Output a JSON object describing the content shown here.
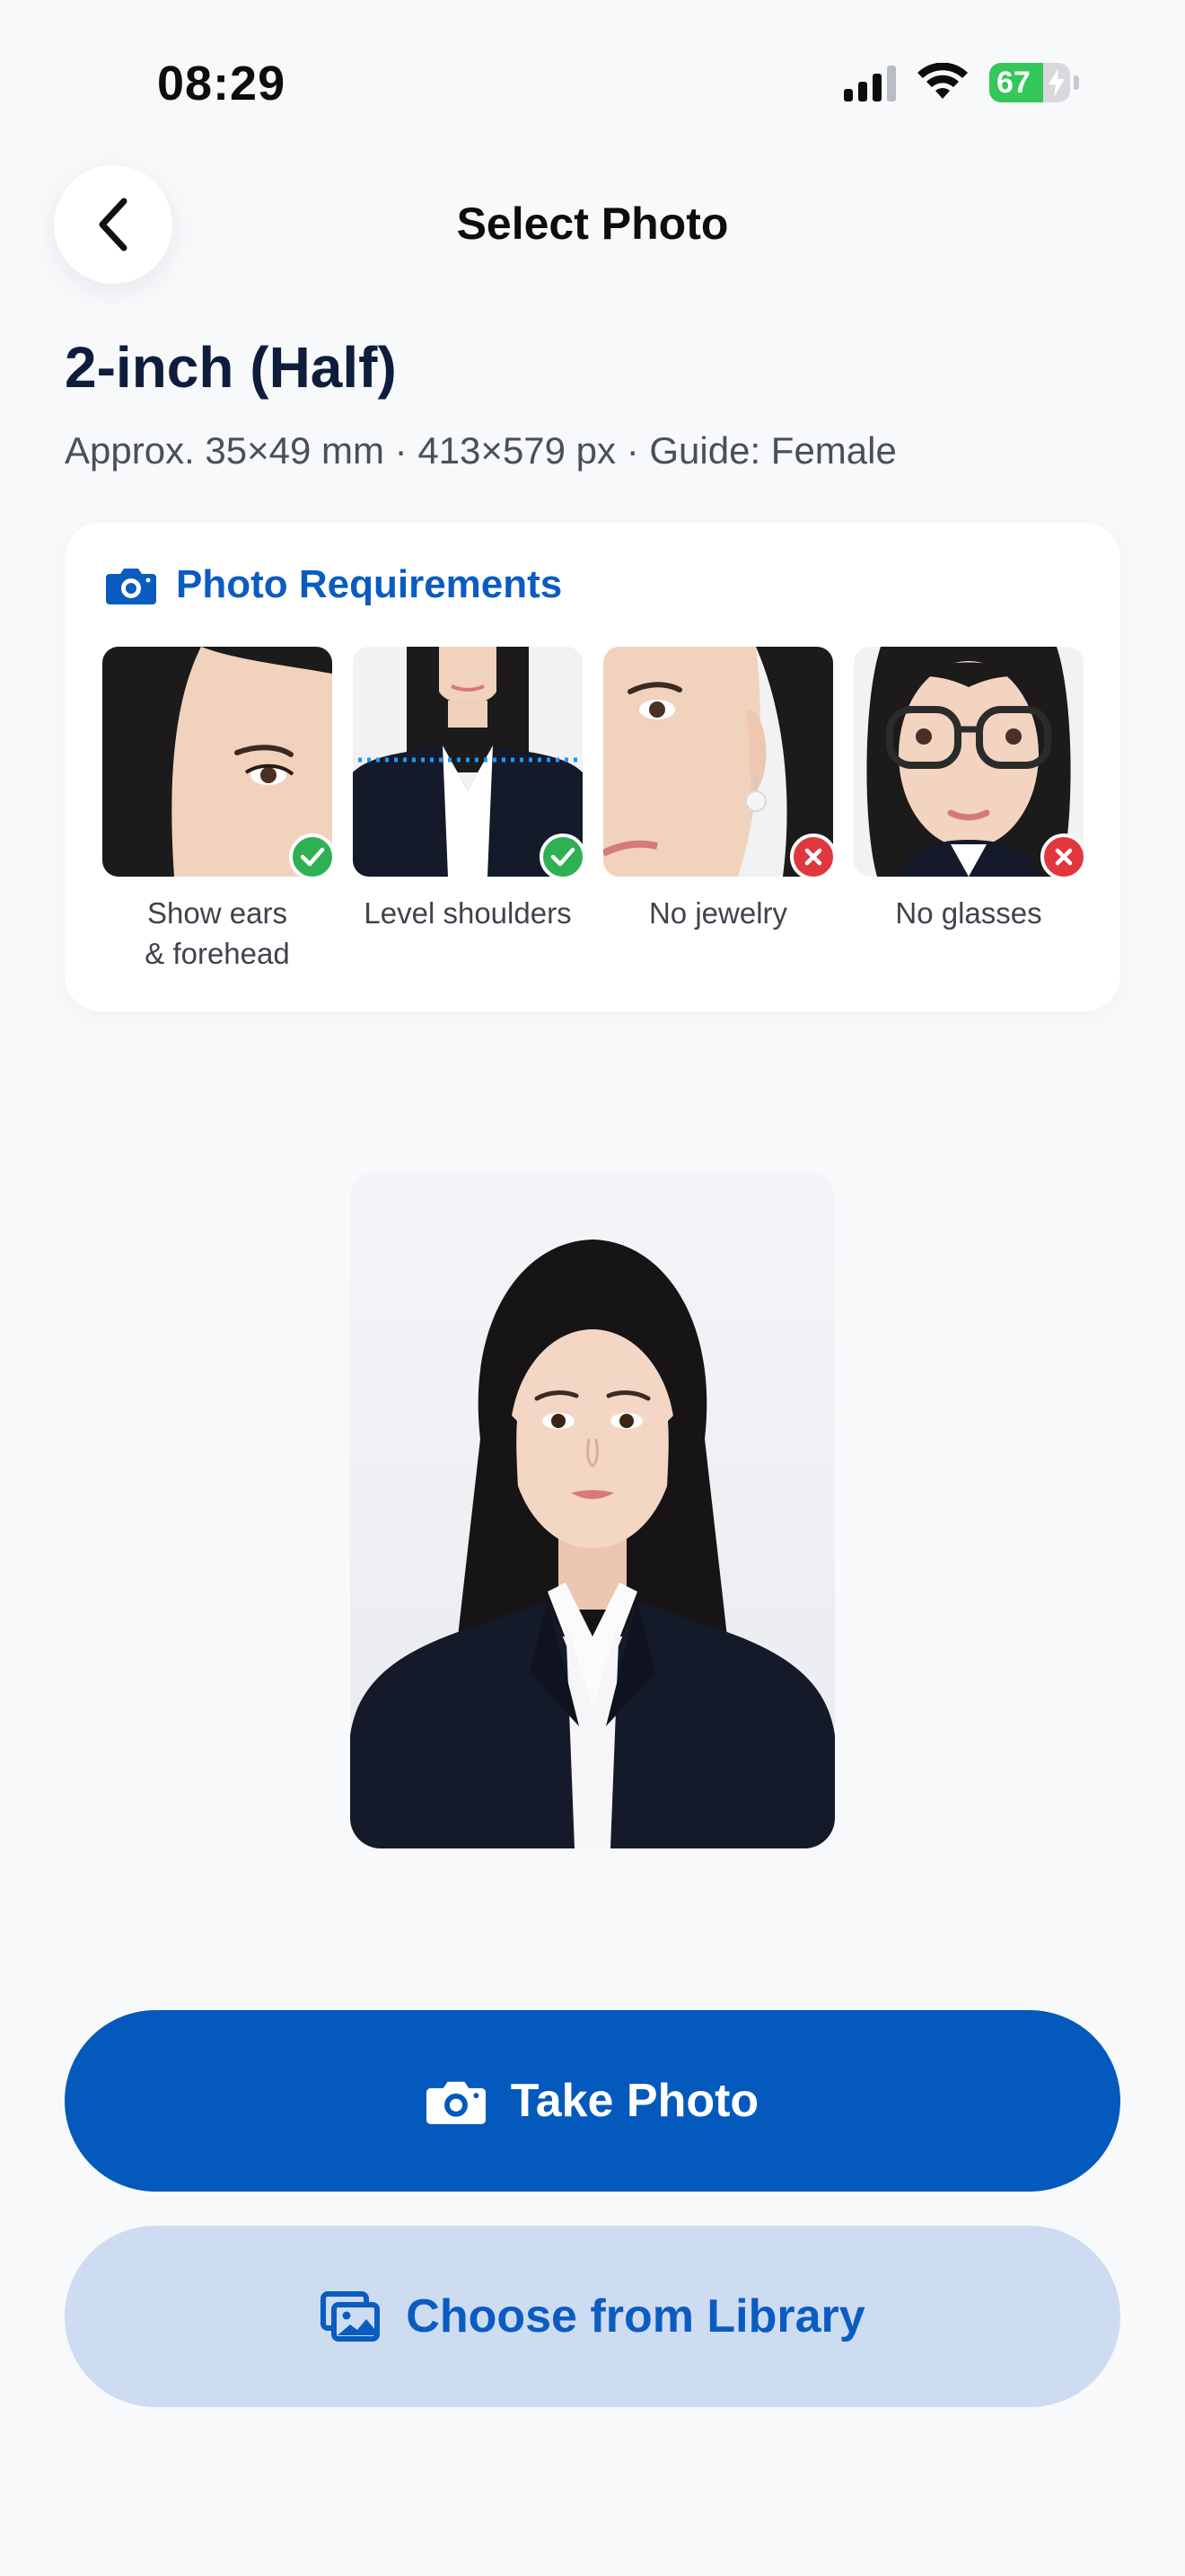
{
  "status_bar": {
    "time": "08:29",
    "battery_level": "67",
    "signal_bars": 3,
    "charging": true
  },
  "header": {
    "title": "Select Photo",
    "back_icon": "chevron-left-icon"
  },
  "size": {
    "title": "2-inch (Half)",
    "subtitle": "Approx. 35×49 mm · 413×579 px · Guide: Female"
  },
  "requirements": {
    "title": "Photo Requirements",
    "icon": "camera-icon",
    "items": [
      {
        "label_line1": "Show ears",
        "label_line2": "& forehead",
        "status": "ok"
      },
      {
        "label_line1": "Level shoulders",
        "label_line2": "",
        "status": "ok"
      },
      {
        "label_line1": "No jewelry",
        "label_line2": "",
        "status": "bad"
      },
      {
        "label_line1": "No glasses",
        "label_line2": "",
        "status": "bad"
      }
    ]
  },
  "actions": {
    "take_photo": "Take Photo",
    "choose_library": "Choose from Library"
  },
  "colors": {
    "accent": "#0459bd",
    "accent_light": "#cddcf1",
    "ok": "#2fb052",
    "bad": "#e0373d",
    "background": "#f8f9fb"
  }
}
